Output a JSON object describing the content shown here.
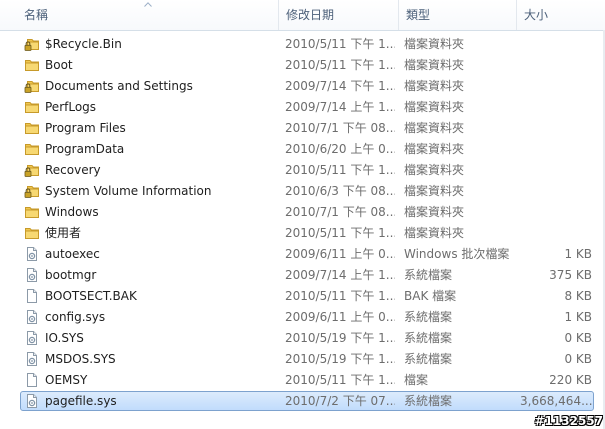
{
  "columns": {
    "name": "名稱",
    "date": "修改日期",
    "type": "類型",
    "size": "大小"
  },
  "files": [
    {
      "name": "$Recycle.Bin",
      "date": "2010/5/11 下午 1...",
      "type": "檔案資料夾",
      "size": "",
      "icon": "locked-folder-icon"
    },
    {
      "name": "Boot",
      "date": "2010/5/11 下午 1...",
      "type": "檔案資料夾",
      "size": "",
      "icon": "folder-icon"
    },
    {
      "name": "Documents and Settings",
      "date": "2009/7/14 下午 1...",
      "type": "檔案資料夾",
      "size": "",
      "icon": "locked-folder-icon"
    },
    {
      "name": "PerfLogs",
      "date": "2009/7/14 上午 1...",
      "type": "檔案資料夾",
      "size": "",
      "icon": "folder-icon"
    },
    {
      "name": "Program Files",
      "date": "2010/7/1 下午 08...",
      "type": "檔案資料夾",
      "size": "",
      "icon": "folder-icon"
    },
    {
      "name": "ProgramData",
      "date": "2010/6/20 上午 0...",
      "type": "檔案資料夾",
      "size": "",
      "icon": "folder-icon"
    },
    {
      "name": "Recovery",
      "date": "2010/5/11 下午 1...",
      "type": "檔案資料夾",
      "size": "",
      "icon": "locked-folder-icon"
    },
    {
      "name": "System Volume Information",
      "date": "2010/6/3 下午 08...",
      "type": "檔案資料夾",
      "size": "",
      "icon": "locked-folder-icon"
    },
    {
      "name": "Windows",
      "date": "2010/7/1 下午 08...",
      "type": "檔案資料夾",
      "size": "",
      "icon": "folder-icon"
    },
    {
      "name": "使用者",
      "date": "2010/5/11 下午 1...",
      "type": "檔案資料夾",
      "size": "",
      "icon": "folder-icon"
    },
    {
      "name": "autoexec",
      "date": "2009/6/11 上午 0...",
      "type": "Windows 批次檔案",
      "size": "1 KB",
      "icon": "settings-file-icon"
    },
    {
      "name": "bootmgr",
      "date": "2009/7/14 上午 1...",
      "type": "系統檔案",
      "size": "375 KB",
      "icon": "settings-file-icon"
    },
    {
      "name": "BOOTSECT.BAK",
      "date": "2010/5/11 下午 1...",
      "type": "BAK 檔案",
      "size": "8 KB",
      "icon": "blank-file-icon"
    },
    {
      "name": "config.sys",
      "date": "2009/6/11 上午 0...",
      "type": "系統檔案",
      "size": "1 KB",
      "icon": "settings-file-icon"
    },
    {
      "name": "IO.SYS",
      "date": "2010/5/19 下午 1...",
      "type": "系統檔案",
      "size": "0 KB",
      "icon": "settings-file-icon"
    },
    {
      "name": "MSDOS.SYS",
      "date": "2010/5/19 下午 1...",
      "type": "系統檔案",
      "size": "0 KB",
      "icon": "settings-file-icon"
    },
    {
      "name": "OEMSY",
      "date": "2010/5/11 下午 1...",
      "type": "檔案",
      "size": "220 KB",
      "icon": "blank-file-icon"
    },
    {
      "name": "pagefile.sys",
      "date": "2010/7/2 下午 07...",
      "type": "系統檔案",
      "size": "3,668,464...",
      "icon": "settings-file-icon",
      "selected": true
    }
  ],
  "watermark": "#1132557",
  "colors": {
    "header_text": "#4c607a",
    "secondary_text": "#6d6d6d",
    "selection_border": "#7da2ce",
    "selection_fill": "#cce0fb",
    "folder": "#f0c74f",
    "lock": "#c9a227"
  }
}
